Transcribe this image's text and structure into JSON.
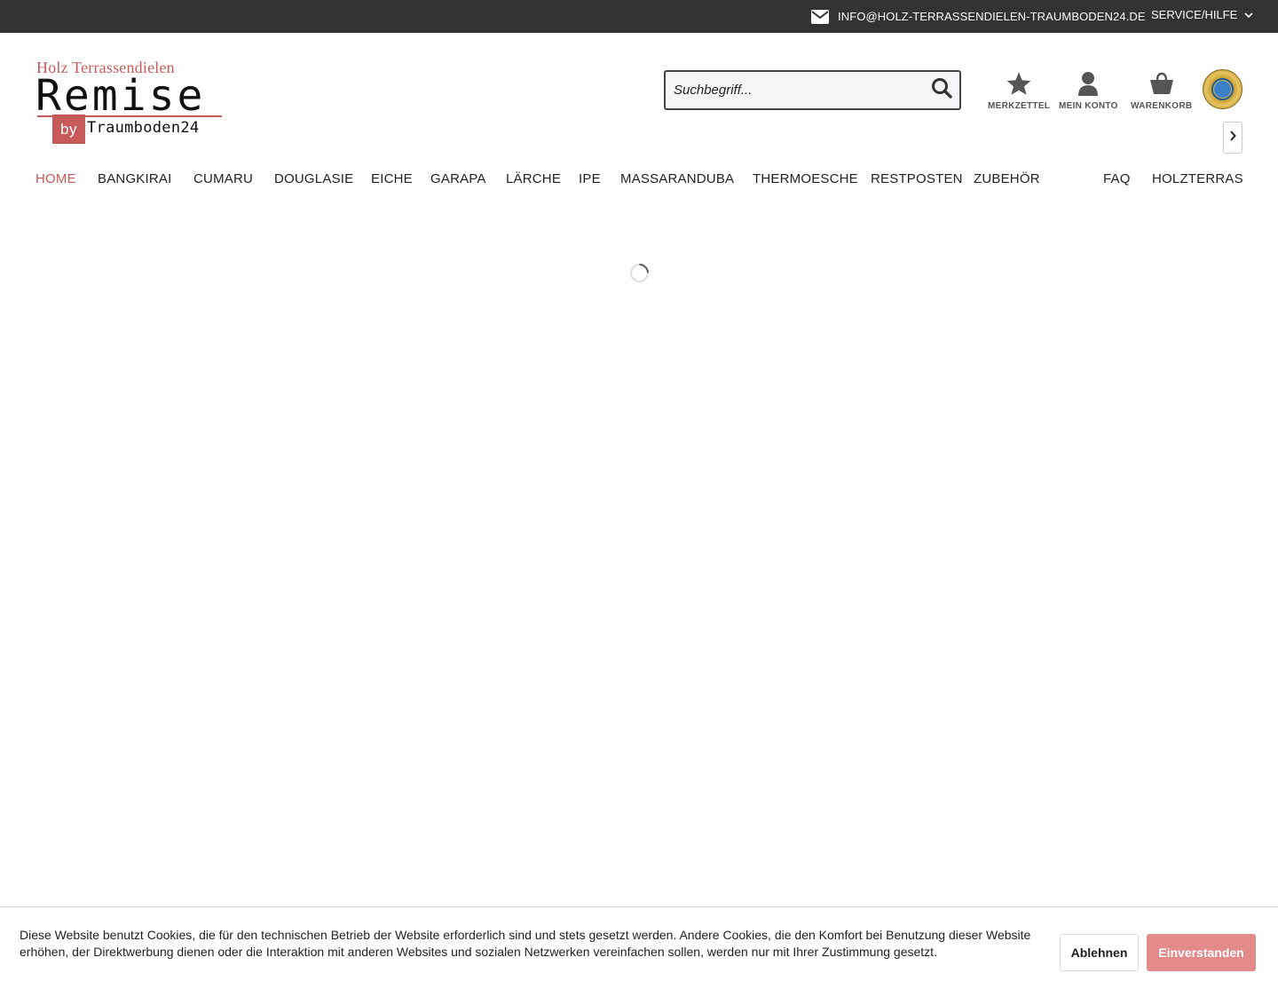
{
  "topbar": {
    "email": "INFO@HOLZ-TERRASSENDIELEN-TRAUMBODEN24.DE",
    "service_label": "SERVICE/HILFE"
  },
  "logo": {
    "line1": "Holz Terrassendielen",
    "line2": "Remise",
    "by": "by",
    "line3": "Traumboden24"
  },
  "search": {
    "placeholder": "Suchbegriff..."
  },
  "account": {
    "wishlist_label": "MERKZETTEL",
    "account_label": "MEIN KONTO",
    "cart_label": "WARENKORB"
  },
  "nav": {
    "items": [
      "HOME",
      "BANGKIRAI",
      "CUMARU",
      "DOUGLASIE",
      "EICHE",
      "GARAPA",
      "LÄRCHE",
      "IPE",
      "MASSARANDUBA",
      "THERMOESCHE",
      "RESTPOSTEN",
      "ZUBEHÖR",
      "FAQ",
      "HOLZTERRASS"
    ],
    "active": "HOME"
  },
  "cookie": {
    "text": "Diese Website benutzt Cookies, die für den technischen Betrieb der Website erforderlich sind und stets gesetzt werden. Andere Cookies, die den Komfort bei Benutzung dieser Website erhöhen, der Direktwerbung dienen oder die Interaktion mit anderen Websites und sozialen Netzwerken vereinfachen sollen, werden nur mit Ihrer Zustimmung gesetzt.",
    "decline_label": "Ablehnen",
    "accept_label": "Einverstanden"
  },
  "colors": {
    "accent": "#c85a5a",
    "topbar_bg": "#333333",
    "accept_button": "#e38b8b"
  }
}
